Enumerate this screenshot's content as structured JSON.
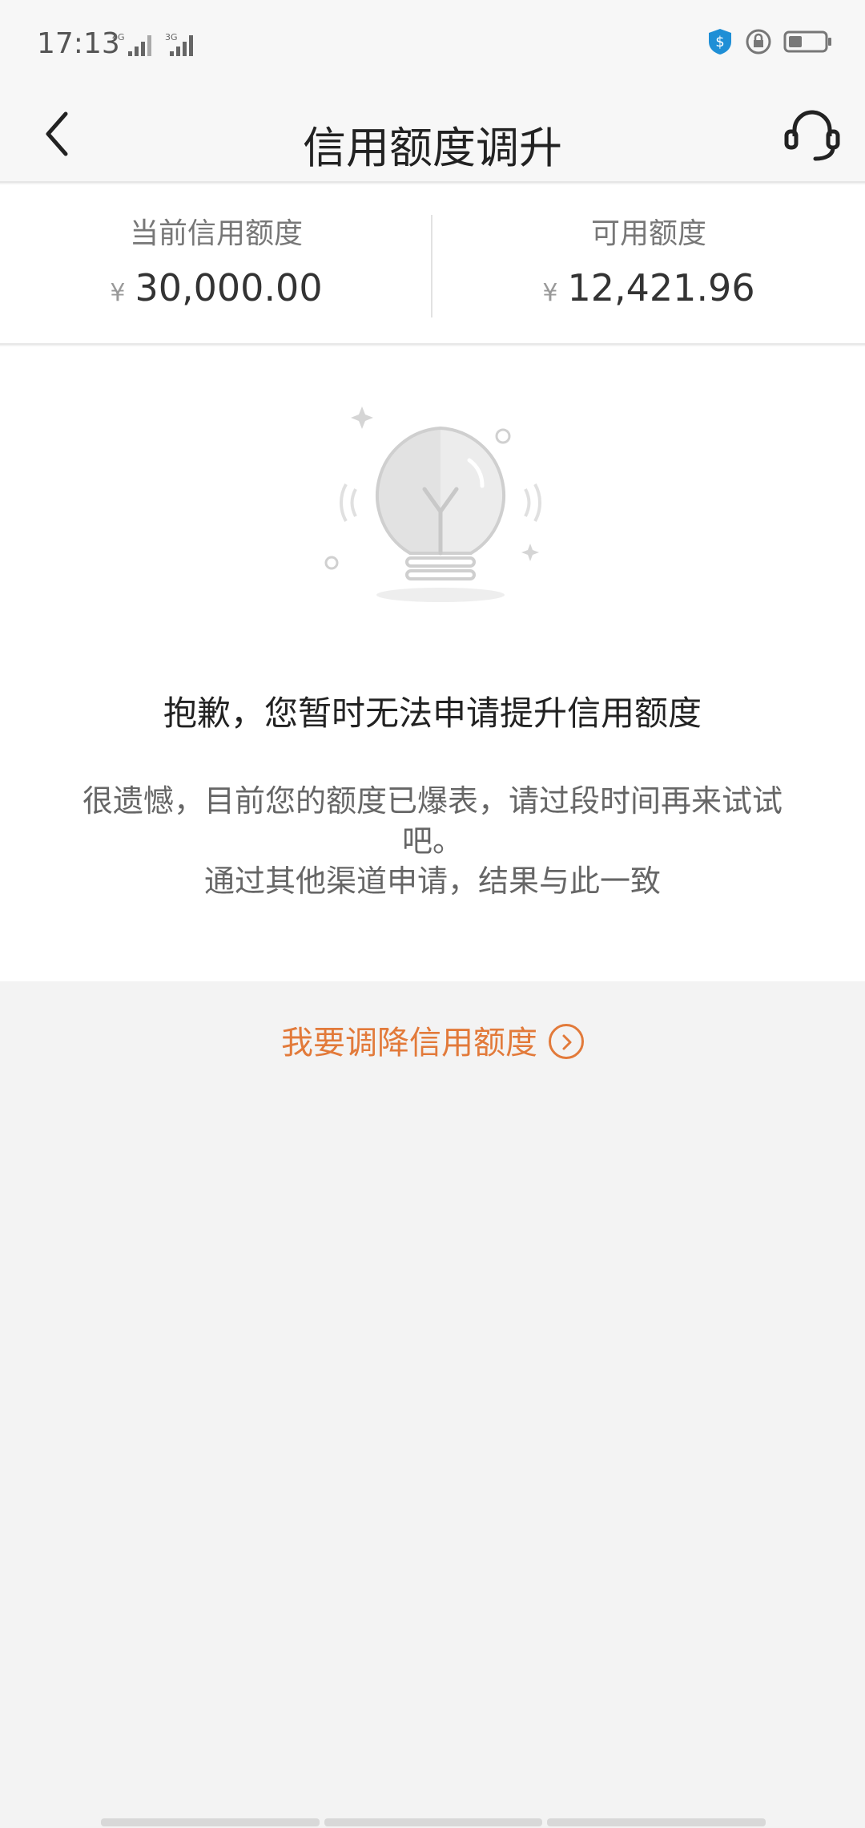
{
  "status_bar": {
    "time": "17:13",
    "signal1_label": "4G",
    "signal2_label": "3G"
  },
  "header": {
    "title": "信用额度调升"
  },
  "credit": {
    "current_label": "当前信用额度",
    "current_value": "30,000.00",
    "available_label": "可用额度",
    "available_value": "12,421.96",
    "currency": "¥"
  },
  "result": {
    "title": "抱歉，您暂时无法申请提升信用额度",
    "line1": "很遗憾，目前您的额度已爆表，请过段时间再来试试吧。",
    "line2": "通过其他渠道申请，结果与此一致"
  },
  "actions": {
    "reduce_label": "我要调降信用额度"
  },
  "colors": {
    "accent": "#e27a3a",
    "page_bg": "#f3f3f3",
    "card_bg": "#ffffff"
  },
  "icons": [
    "back-icon",
    "customer-service-icon",
    "lightbulb-icon",
    "chevron-right-circle-icon",
    "shield-icon",
    "lock-icon",
    "battery-icon"
  ]
}
